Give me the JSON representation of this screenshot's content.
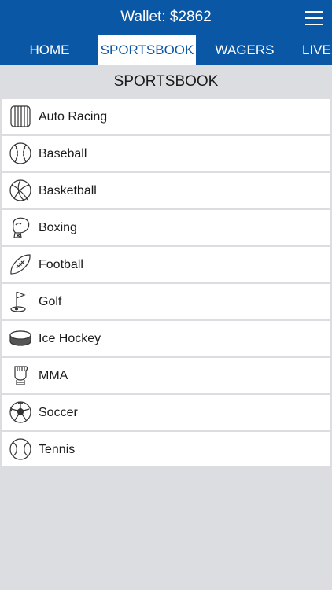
{
  "header": {
    "wallet_label": "Wallet: $2862",
    "menu_icon": "hamburger-menu-icon",
    "background_color": "#0a57a6"
  },
  "tabs": [
    {
      "label": "HOME",
      "active": false
    },
    {
      "label": "SPORTSBOOK",
      "active": true
    },
    {
      "label": "WAGERS",
      "active": false
    },
    {
      "label": "LIVE",
      "active": false
    }
  ],
  "page": {
    "title": "SPORTSBOOK"
  },
  "sports": [
    {
      "label": "Auto Racing",
      "icon": "tire-icon"
    },
    {
      "label": "Baseball",
      "icon": "baseball-icon"
    },
    {
      "label": "Basketball",
      "icon": "basketball-icon"
    },
    {
      "label": "Boxing",
      "icon": "boxing-glove-icon"
    },
    {
      "label": "Football",
      "icon": "football-icon"
    },
    {
      "label": "Golf",
      "icon": "golf-flag-icon"
    },
    {
      "label": "Ice Hockey",
      "icon": "hockey-puck-icon"
    },
    {
      "label": "MMA",
      "icon": "mma-glove-icon"
    },
    {
      "label": "Soccer",
      "icon": "soccer-ball-icon"
    },
    {
      "label": "Tennis",
      "icon": "tennis-ball-icon"
    }
  ]
}
